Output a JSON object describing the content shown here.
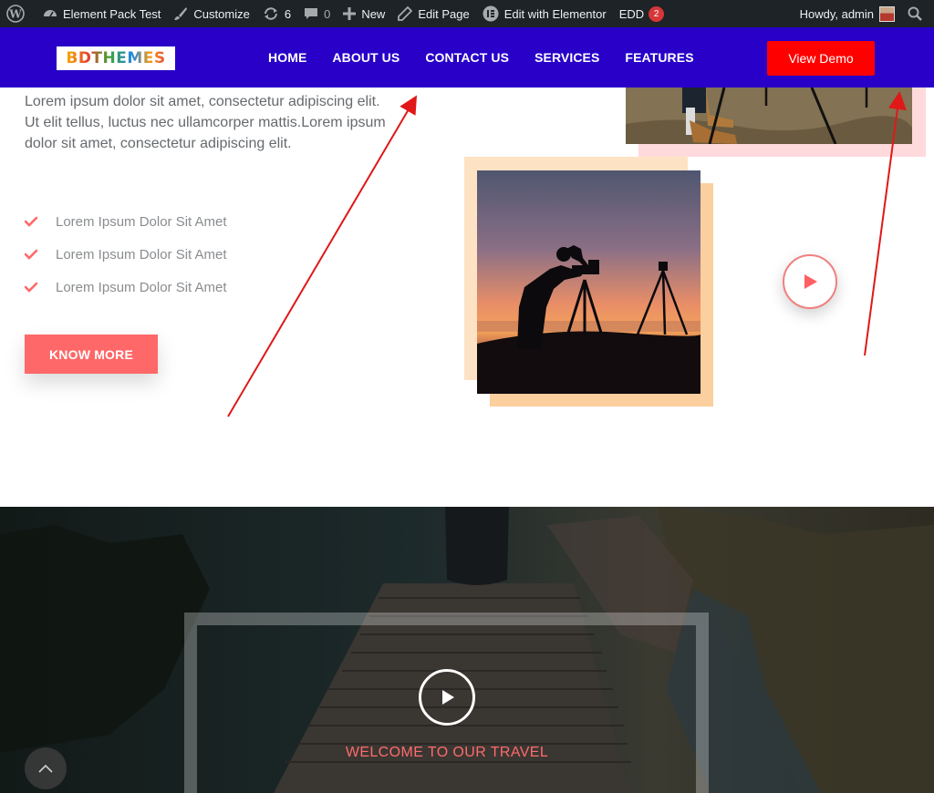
{
  "adminbar": {
    "site_name": "Element Pack Test",
    "customize": "Customize",
    "updates_count": "6",
    "comments_count": "0",
    "new": "New",
    "edit_page": "Edit Page",
    "edit_elementor": "Edit with Elementor",
    "edd": "EDD",
    "edd_badge": "2",
    "howdy": "Howdy, admin"
  },
  "header": {
    "logo": "BDTHEMES",
    "nav": [
      "HOME",
      "ABOUT US",
      "CONTACT US",
      "SERVICES",
      "FEATURES"
    ],
    "cta": "View Demo",
    "bg_color": "#2800c8",
    "cta_color": "#ff0000"
  },
  "content": {
    "intro": "Lorem ipsum dolor sit amet, consectetur adipiscing elit. Ut elit tellus, luctus nec ullamcorper mattis.Lorem ipsum dolor sit amet, consectetur adipiscing elit.",
    "checklist": [
      "Lorem Ipsum Dolor Sit Amet",
      "Lorem Ipsum Dolor Sit Amet",
      "Lorem Ipsum Dolor Sit Amet"
    ],
    "button": "KNOW MORE",
    "accent_color": "#ff6868"
  },
  "hero": {
    "title": "WELCOME TO OUR TRAVEL"
  },
  "icons": [
    "wordpress-icon",
    "dashboard-icon",
    "brush-icon",
    "updates-icon",
    "comment-icon",
    "plus-icon",
    "pencil-icon",
    "elementor-icon",
    "search-icon",
    "check-icon",
    "play-icon",
    "chevron-up-icon"
  ]
}
